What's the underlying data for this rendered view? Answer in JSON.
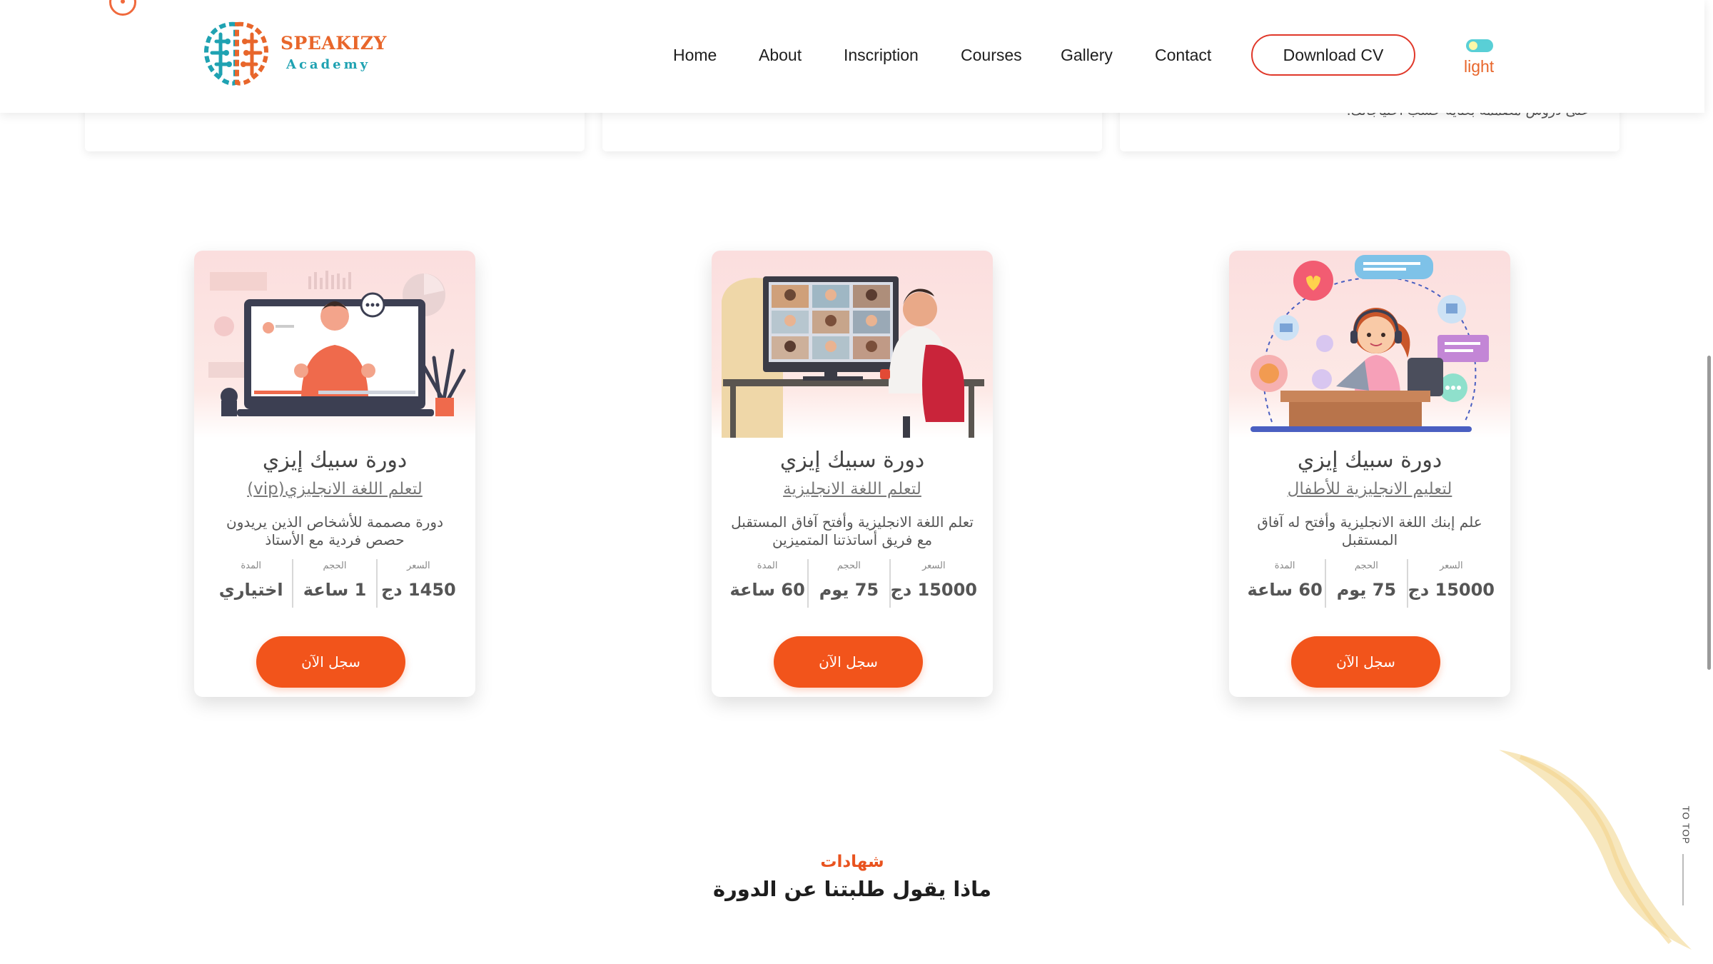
{
  "header": {
    "logo": {
      "name": "SPEAKIZY",
      "sub": "Academy"
    },
    "nav": [
      {
        "label": "Home"
      },
      {
        "label": "About"
      },
      {
        "label": "Inscription"
      },
      {
        "label": "Courses"
      },
      {
        "label": "Gallery"
      },
      {
        "label": "Contact"
      }
    ],
    "cv_button": "Download CV",
    "theme_toggle_label": "light"
  },
  "upper_cards": [
    {
      "text": ""
    },
    {
      "text": ""
    },
    {
      "text": "على دروس مصممة بعناية حسب احتياجاتك."
    }
  ],
  "courses": [
    {
      "title": "دورة سبيك إيزي",
      "subtitle": "لتعلم اللغة الانجليزي(vip)",
      "description": "دورة مصممة للأشخاص الذين يريدون حصص فردية مع الأستاذ",
      "stats": [
        {
          "label": "السعر",
          "value": "1450 دج"
        },
        {
          "label": "الحجم",
          "value": "1 ساعة"
        },
        {
          "label": "المدة",
          "value": "اختياري"
        }
      ],
      "button": "سجل الآن"
    },
    {
      "title": "دورة سبيك إيزي",
      "subtitle": "لتعلم اللغة الانجليزية",
      "description": "تعلم اللغة الانجليزية وأفتح آفاق المستقبل مع فريق أساتذتنا المتميزين",
      "stats": [
        {
          "label": "السعر",
          "value": "15000 دج"
        },
        {
          "label": "الحجم",
          "value": "75 يوم"
        },
        {
          "label": "المدة",
          "value": "60 ساعة"
        }
      ],
      "button": "سجل الآن"
    },
    {
      "title": "دورة سبيك إيزي",
      "subtitle": "لتعليم الانجليزية للأطفال",
      "description": "علم إبنك اللغة الانجليزية وأفتح له آفاق المستقبل",
      "stats": [
        {
          "label": "السعر",
          "value": "15000 دج"
        },
        {
          "label": "الحجم",
          "value": "75 يوم"
        },
        {
          "label": "المدة",
          "value": "60 ساعة"
        }
      ],
      "button": "سجل الآن"
    }
  ],
  "testimonials": {
    "kicker": "شهادات",
    "title": "ماذا يقول طلبتنا عن الدورة"
  },
  "to_top": "TO TOP",
  "colors": {
    "accent": "#f2541b",
    "brand_orange": "#e8662b",
    "brand_teal": "#1fa2b2"
  }
}
